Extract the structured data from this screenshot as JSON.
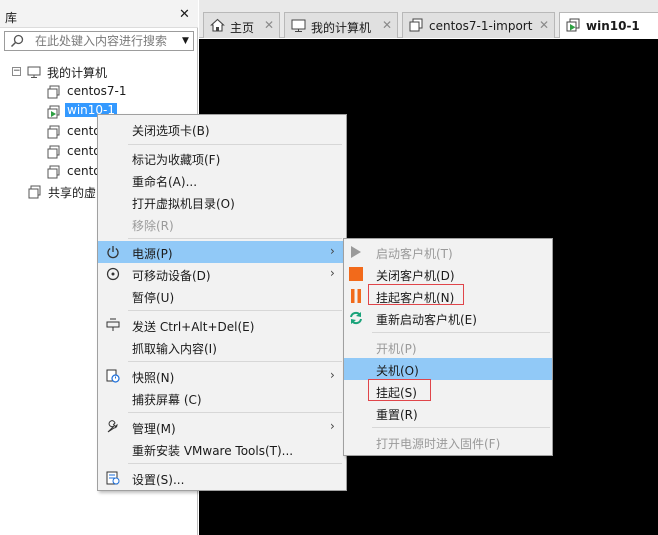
{
  "library": {
    "title": "库",
    "close_glyph": "✕",
    "search_placeholder": "在此处键入内容进行搜索",
    "tree": {
      "root": "我的计算机",
      "vms": [
        "centos7-1",
        "win10-1",
        "cento",
        "cento",
        "cento"
      ],
      "shared": "共享的虚"
    }
  },
  "tabs": [
    {
      "label": "主页",
      "icon": "home-icon"
    },
    {
      "label": "我的计算机",
      "icon": "computer-icon"
    },
    {
      "label": "centos7-1-import",
      "icon": "vm-icon"
    },
    {
      "label": "win10-1",
      "icon": "vm-running-icon",
      "active": true
    }
  ],
  "tab_close_glyph": "✕",
  "context_menu": {
    "close_tab": "关闭选项卡(B)",
    "mark_favorite": "标记为收藏项(F)",
    "rename": "重命名(A)...",
    "open_vm_dir": "打开虚拟机目录(O)",
    "remove": "移除(R)",
    "power": "电源(P)",
    "removable_devices": "可移动设备(D)",
    "pause": "暂停(U)",
    "send_cad": "发送 Ctrl+Alt+Del(E)",
    "grab_input": "抓取输入内容(I)",
    "snapshot": "快照(N)",
    "capture_screen": "捕获屏幕 (C)",
    "manage": "管理(M)",
    "reinstall_tools": "重新安装 VMware Tools(T)...",
    "settings": "设置(S)..."
  },
  "power_menu": {
    "start_guest": "启动客户机(T)",
    "shutdown_guest": "关闭客户机(D)",
    "suspend_guest": "挂起客户机(N)",
    "restart_guest": "重新启动客户机(E)",
    "power_on": "开机(P)",
    "power_off": "关机(O)",
    "suspend": "挂起(S)",
    "reset": "重置(R)",
    "power_on_firmware": "打开电源时进入固件(F)"
  },
  "colors": {
    "highlight": "#91c9f7",
    "selection": "#3399ff",
    "stop_orange": "#f26a1b",
    "restart_green": "#1aa37a",
    "annotation_red": "#e0454a"
  }
}
